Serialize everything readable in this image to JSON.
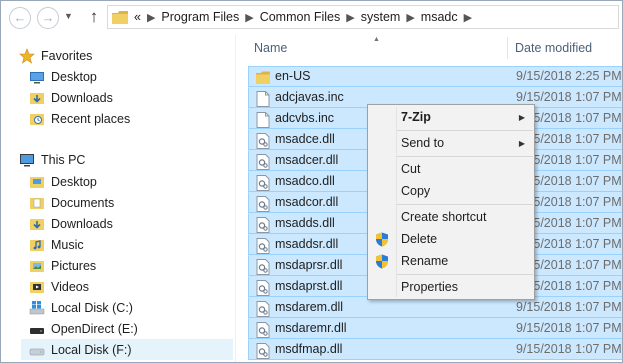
{
  "address": {
    "overflow": "«",
    "crumbs": [
      "Program Files",
      "Common Files",
      "system",
      "msadc"
    ]
  },
  "nav": {
    "items": [
      {
        "label": "Favorites",
        "icon": "star-icon"
      },
      {
        "label": "Desktop",
        "icon": "desktop-icon"
      },
      {
        "label": "Downloads",
        "icon": "downloads-folder-icon"
      },
      {
        "label": "Recent places",
        "icon": "recent-places-icon"
      },
      {
        "label": "This PC",
        "icon": "computer-icon"
      },
      {
        "label": "Desktop",
        "icon": "folder-icon"
      },
      {
        "label": "Documents",
        "icon": "folder-icon"
      },
      {
        "label": "Downloads",
        "icon": "downloads-folder-icon"
      },
      {
        "label": "Music",
        "icon": "music-folder-icon"
      },
      {
        "label": "Pictures",
        "icon": "pictures-folder-icon"
      },
      {
        "label": "Videos",
        "icon": "videos-folder-icon"
      },
      {
        "label": "Local Disk (C:)",
        "icon": "windows-drive-icon"
      },
      {
        "label": "OpenDirect (E:)",
        "icon": "drive-icon"
      },
      {
        "label": "Local Disk (F:)",
        "icon": "drive-icon"
      }
    ]
  },
  "columns": {
    "name": "Name",
    "date": "Date modified"
  },
  "files": [
    {
      "name": "en-US",
      "date": "9/15/2018 2:25 PM",
      "icon": "folder-icon"
    },
    {
      "name": "adcjavas.inc",
      "date": "9/15/2018 1:07 PM",
      "icon": "file-icon"
    },
    {
      "name": "adcvbs.inc",
      "date": "9/15/2018 1:07 PM",
      "icon": "file-icon"
    },
    {
      "name": "msadce.dll",
      "date": "9/15/2018 1:07 PM",
      "icon": "dll-icon"
    },
    {
      "name": "msadcer.dll",
      "date": "9/15/2018 1:07 PM",
      "icon": "dll-icon"
    },
    {
      "name": "msadco.dll",
      "date": "9/15/2018 1:07 PM",
      "icon": "dll-icon"
    },
    {
      "name": "msadcor.dll",
      "date": "9/15/2018 1:07 PM",
      "icon": "dll-icon"
    },
    {
      "name": "msadds.dll",
      "date": "9/15/2018 1:07 PM",
      "icon": "dll-icon"
    },
    {
      "name": "msaddsr.dll",
      "date": "9/15/2018 1:07 PM",
      "icon": "dll-icon"
    },
    {
      "name": "msdaprsr.dll",
      "date": "9/15/2018 1:07 PM",
      "icon": "dll-icon"
    },
    {
      "name": "msdaprst.dll",
      "date": "9/15/2018 1:07 PM",
      "icon": "dll-icon"
    },
    {
      "name": "msdarem.dll",
      "date": "9/15/2018 1:07 PM",
      "icon": "dll-icon"
    },
    {
      "name": "msdaremr.dll",
      "date": "9/15/2018 1:07 PM",
      "icon": "dll-icon"
    },
    {
      "name": "msdfmap.dll",
      "date": "9/15/2018 1:07 PM",
      "icon": "dll-icon"
    }
  ],
  "context_menu": {
    "items": [
      {
        "label": "7-Zip",
        "submenu": true
      },
      {
        "label": "Send to",
        "submenu": true
      },
      {
        "label": "Cut"
      },
      {
        "label": "Copy"
      },
      {
        "label": "Create shortcut"
      },
      {
        "label": "Delete",
        "icon": "uac-shield-icon"
      },
      {
        "label": "Rename",
        "icon": "uac-shield-icon"
      },
      {
        "label": "Properties"
      }
    ]
  },
  "colors": {
    "selection": "#cce8ff",
    "selection_border": "#99d1ff",
    "folder": "#e8c04a",
    "header_text": "#4c607a"
  }
}
